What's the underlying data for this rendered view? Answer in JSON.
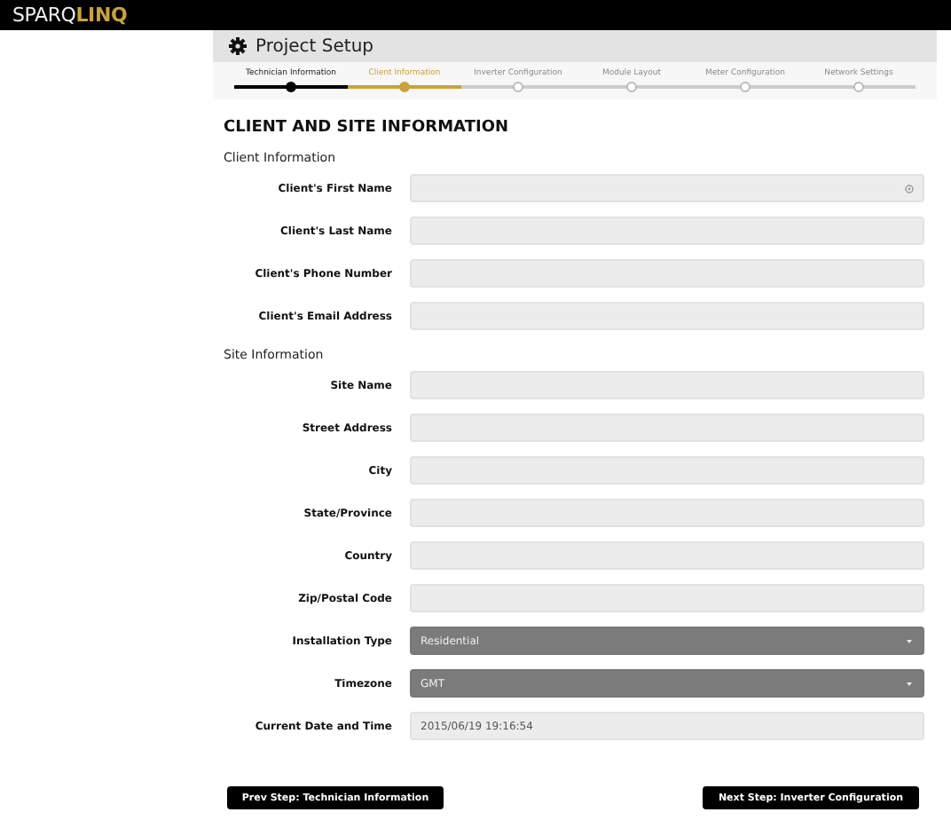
{
  "header": {
    "logo_light": "SPARQ",
    "logo_bold": "LINQ"
  },
  "panel": {
    "title": "Project Setup"
  },
  "steps": [
    {
      "label": "Technician Information",
      "completed": true,
      "selected": false
    },
    {
      "label": "Client Information",
      "completed": false,
      "selected": true
    },
    {
      "label": "Inverter Configuration",
      "completed": false,
      "selected": false
    },
    {
      "label": "Module Layout",
      "completed": false,
      "selected": false
    },
    {
      "label": "Meter Configuration",
      "completed": false,
      "selected": false
    },
    {
      "label": "Network Settings",
      "completed": false,
      "selected": false
    }
  ],
  "heading": "CLIENT AND SITE INFORMATION",
  "sections": [
    {
      "title": "Client Information",
      "fields": [
        {
          "label": "Client's First Name",
          "kind": "text",
          "autofill_icon": true
        },
        {
          "label": "Client's Last Name",
          "kind": "text"
        },
        {
          "label": "Client's Phone Number",
          "kind": "text"
        },
        {
          "label": "Client's Email Address",
          "kind": "text"
        }
      ]
    },
    {
      "title": "Site Information",
      "fields": [
        {
          "label": "Site Name",
          "kind": "text"
        },
        {
          "label": "Street Address",
          "kind": "text"
        },
        {
          "label": "City",
          "kind": "text"
        },
        {
          "label": "State/Province",
          "kind": "text"
        },
        {
          "label": "Country",
          "kind": "text"
        },
        {
          "label": "Zip/Postal Code",
          "kind": "text"
        },
        {
          "label": "Installation Type",
          "kind": "select",
          "value": "Residential"
        },
        {
          "label": "Timezone",
          "kind": "select",
          "value": "GMT"
        },
        {
          "label": "Current Date and Time",
          "kind": "text",
          "value": "2015/06/19 19:16:54"
        }
      ]
    }
  ],
  "buttons": {
    "prev": "Prev Step: Technician Information",
    "next": "Next Step: Inverter Configuration"
  }
}
